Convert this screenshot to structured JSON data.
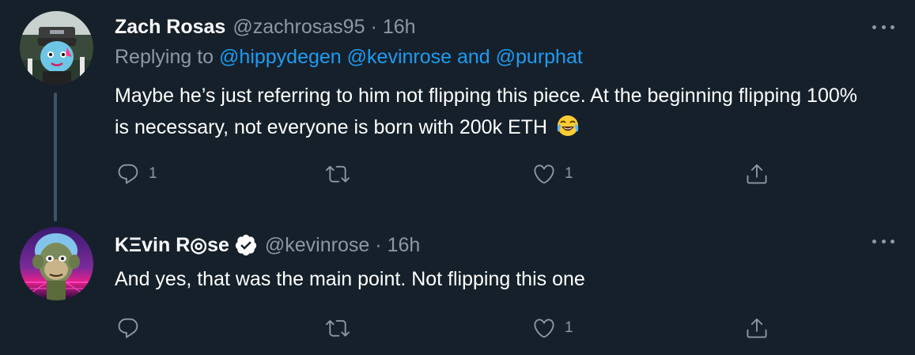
{
  "tweets": [
    {
      "name": "Zach Rosas",
      "handle": "@zachrosas95",
      "separator": "·",
      "time": "16h",
      "verified": false,
      "replying_prefix": "Replying to ",
      "mentions": [
        "@hippydegen",
        "@kevinrose"
      ],
      "mention_joiner": " and ",
      "mention_last": "@purphat",
      "text": "Maybe he’s just referring to him not flipping this piece. At the beginning flipping 100% is necessary, not everyone is born with 200k ETH",
      "emoji": "face-with-tears-of-joy",
      "reply_count": "1",
      "retweet_count": "",
      "like_count": "1",
      "avatar_icon": "masked-character-avatar"
    },
    {
      "name": "KΞvin R◎se",
      "handle": "@kevinrose",
      "separator": "·",
      "time": "16h",
      "verified": true,
      "text": "And yes, that was the main point. Not flipping this one",
      "reply_count": "",
      "retweet_count": "",
      "like_count": "1",
      "avatar_icon": "ape-avatar"
    }
  ],
  "colors": {
    "background": "#15202b",
    "text": "#ffffff",
    "secondary": "#8b98a5",
    "accent": "#1d9bf0",
    "thread_line": "#3d5466"
  },
  "icons": {
    "reply": "reply-icon",
    "retweet": "retweet-icon",
    "like": "heart-icon",
    "share": "share-icon",
    "more": "more-icon",
    "verified": "verified-badge-icon"
  }
}
